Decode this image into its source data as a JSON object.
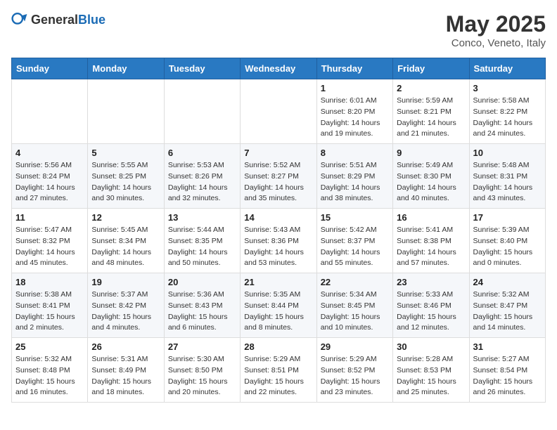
{
  "header": {
    "logo_general": "General",
    "logo_blue": "Blue",
    "title": "May 2025",
    "location": "Conco, Veneto, Italy"
  },
  "columns": [
    "Sunday",
    "Monday",
    "Tuesday",
    "Wednesday",
    "Thursday",
    "Friday",
    "Saturday"
  ],
  "weeks": [
    [
      {
        "day": "",
        "detail": ""
      },
      {
        "day": "",
        "detail": ""
      },
      {
        "day": "",
        "detail": ""
      },
      {
        "day": "",
        "detail": ""
      },
      {
        "day": "1",
        "detail": "Sunrise: 6:01 AM\nSunset: 8:20 PM\nDaylight: 14 hours\nand 19 minutes."
      },
      {
        "day": "2",
        "detail": "Sunrise: 5:59 AM\nSunset: 8:21 PM\nDaylight: 14 hours\nand 21 minutes."
      },
      {
        "day": "3",
        "detail": "Sunrise: 5:58 AM\nSunset: 8:22 PM\nDaylight: 14 hours\nand 24 minutes."
      }
    ],
    [
      {
        "day": "4",
        "detail": "Sunrise: 5:56 AM\nSunset: 8:24 PM\nDaylight: 14 hours\nand 27 minutes."
      },
      {
        "day": "5",
        "detail": "Sunrise: 5:55 AM\nSunset: 8:25 PM\nDaylight: 14 hours\nand 30 minutes."
      },
      {
        "day": "6",
        "detail": "Sunrise: 5:53 AM\nSunset: 8:26 PM\nDaylight: 14 hours\nand 32 minutes."
      },
      {
        "day": "7",
        "detail": "Sunrise: 5:52 AM\nSunset: 8:27 PM\nDaylight: 14 hours\nand 35 minutes."
      },
      {
        "day": "8",
        "detail": "Sunrise: 5:51 AM\nSunset: 8:29 PM\nDaylight: 14 hours\nand 38 minutes."
      },
      {
        "day": "9",
        "detail": "Sunrise: 5:49 AM\nSunset: 8:30 PM\nDaylight: 14 hours\nand 40 minutes."
      },
      {
        "day": "10",
        "detail": "Sunrise: 5:48 AM\nSunset: 8:31 PM\nDaylight: 14 hours\nand 43 minutes."
      }
    ],
    [
      {
        "day": "11",
        "detail": "Sunrise: 5:47 AM\nSunset: 8:32 PM\nDaylight: 14 hours\nand 45 minutes."
      },
      {
        "day": "12",
        "detail": "Sunrise: 5:45 AM\nSunset: 8:34 PM\nDaylight: 14 hours\nand 48 minutes."
      },
      {
        "day": "13",
        "detail": "Sunrise: 5:44 AM\nSunset: 8:35 PM\nDaylight: 14 hours\nand 50 minutes."
      },
      {
        "day": "14",
        "detail": "Sunrise: 5:43 AM\nSunset: 8:36 PM\nDaylight: 14 hours\nand 53 minutes."
      },
      {
        "day": "15",
        "detail": "Sunrise: 5:42 AM\nSunset: 8:37 PM\nDaylight: 14 hours\nand 55 minutes."
      },
      {
        "day": "16",
        "detail": "Sunrise: 5:41 AM\nSunset: 8:38 PM\nDaylight: 14 hours\nand 57 minutes."
      },
      {
        "day": "17",
        "detail": "Sunrise: 5:39 AM\nSunset: 8:40 PM\nDaylight: 15 hours\nand 0 minutes."
      }
    ],
    [
      {
        "day": "18",
        "detail": "Sunrise: 5:38 AM\nSunset: 8:41 PM\nDaylight: 15 hours\nand 2 minutes."
      },
      {
        "day": "19",
        "detail": "Sunrise: 5:37 AM\nSunset: 8:42 PM\nDaylight: 15 hours\nand 4 minutes."
      },
      {
        "day": "20",
        "detail": "Sunrise: 5:36 AM\nSunset: 8:43 PM\nDaylight: 15 hours\nand 6 minutes."
      },
      {
        "day": "21",
        "detail": "Sunrise: 5:35 AM\nSunset: 8:44 PM\nDaylight: 15 hours\nand 8 minutes."
      },
      {
        "day": "22",
        "detail": "Sunrise: 5:34 AM\nSunset: 8:45 PM\nDaylight: 15 hours\nand 10 minutes."
      },
      {
        "day": "23",
        "detail": "Sunrise: 5:33 AM\nSunset: 8:46 PM\nDaylight: 15 hours\nand 12 minutes."
      },
      {
        "day": "24",
        "detail": "Sunrise: 5:32 AM\nSunset: 8:47 PM\nDaylight: 15 hours\nand 14 minutes."
      }
    ],
    [
      {
        "day": "25",
        "detail": "Sunrise: 5:32 AM\nSunset: 8:48 PM\nDaylight: 15 hours\nand 16 minutes."
      },
      {
        "day": "26",
        "detail": "Sunrise: 5:31 AM\nSunset: 8:49 PM\nDaylight: 15 hours\nand 18 minutes."
      },
      {
        "day": "27",
        "detail": "Sunrise: 5:30 AM\nSunset: 8:50 PM\nDaylight: 15 hours\nand 20 minutes."
      },
      {
        "day": "28",
        "detail": "Sunrise: 5:29 AM\nSunset: 8:51 PM\nDaylight: 15 hours\nand 22 minutes."
      },
      {
        "day": "29",
        "detail": "Sunrise: 5:29 AM\nSunset: 8:52 PM\nDaylight: 15 hours\nand 23 minutes."
      },
      {
        "day": "30",
        "detail": "Sunrise: 5:28 AM\nSunset: 8:53 PM\nDaylight: 15 hours\nand 25 minutes."
      },
      {
        "day": "31",
        "detail": "Sunrise: 5:27 AM\nSunset: 8:54 PM\nDaylight: 15 hours\nand 26 minutes."
      }
    ]
  ]
}
